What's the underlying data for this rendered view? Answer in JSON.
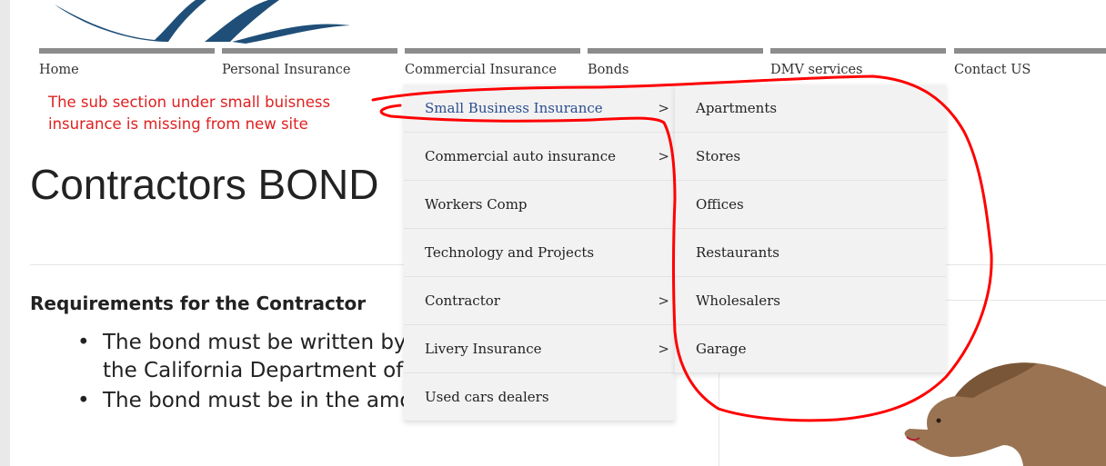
{
  "nav": {
    "items": [
      {
        "label": "Home"
      },
      {
        "label": "Personal Insurance"
      },
      {
        "label": "Commercial Insurance"
      },
      {
        "label": "Bonds"
      },
      {
        "label": "DMV services"
      },
      {
        "label": "Contact US"
      }
    ]
  },
  "annotation": {
    "note_text": "The sub section under small buisness insurance is missing from new site",
    "color": "#e02020"
  },
  "page": {
    "title": "Contractors BOND",
    "section_heading": "Requirements for the Contractor",
    "bullets": [
      "The bond must be written by a surety licensed through the California Department of Insurance.",
      "The bond must be in the amount of $12,500."
    ]
  },
  "dropdown": {
    "items": [
      {
        "label": "Small Business Insurance",
        "arrow": ">",
        "active": true
      },
      {
        "label": "Commercial auto insurance",
        "arrow": ">"
      },
      {
        "label": "Workers Comp",
        "arrow": ""
      },
      {
        "label": "Technology and Projects",
        "arrow": ""
      },
      {
        "label": "Contractor",
        "arrow": ">"
      },
      {
        "label": "Livery Insurance",
        "arrow": ">"
      },
      {
        "label": "Used cars dealers",
        "arrow": ""
      }
    ],
    "submenu": [
      {
        "label": "Apartments"
      },
      {
        "label": "Stores"
      },
      {
        "label": "Offices"
      },
      {
        "label": "Restaurants"
      },
      {
        "label": "Wholesalers"
      },
      {
        "label": "Garage"
      }
    ]
  },
  "colors": {
    "nav_bar": "#8c8c8c",
    "menu_bg": "#f2f2f2",
    "active_link": "#2a4d8f",
    "logo": "#1f4f78"
  },
  "icons": {
    "logo": "wave-logo-icon",
    "bear": "california-bear-icon"
  }
}
